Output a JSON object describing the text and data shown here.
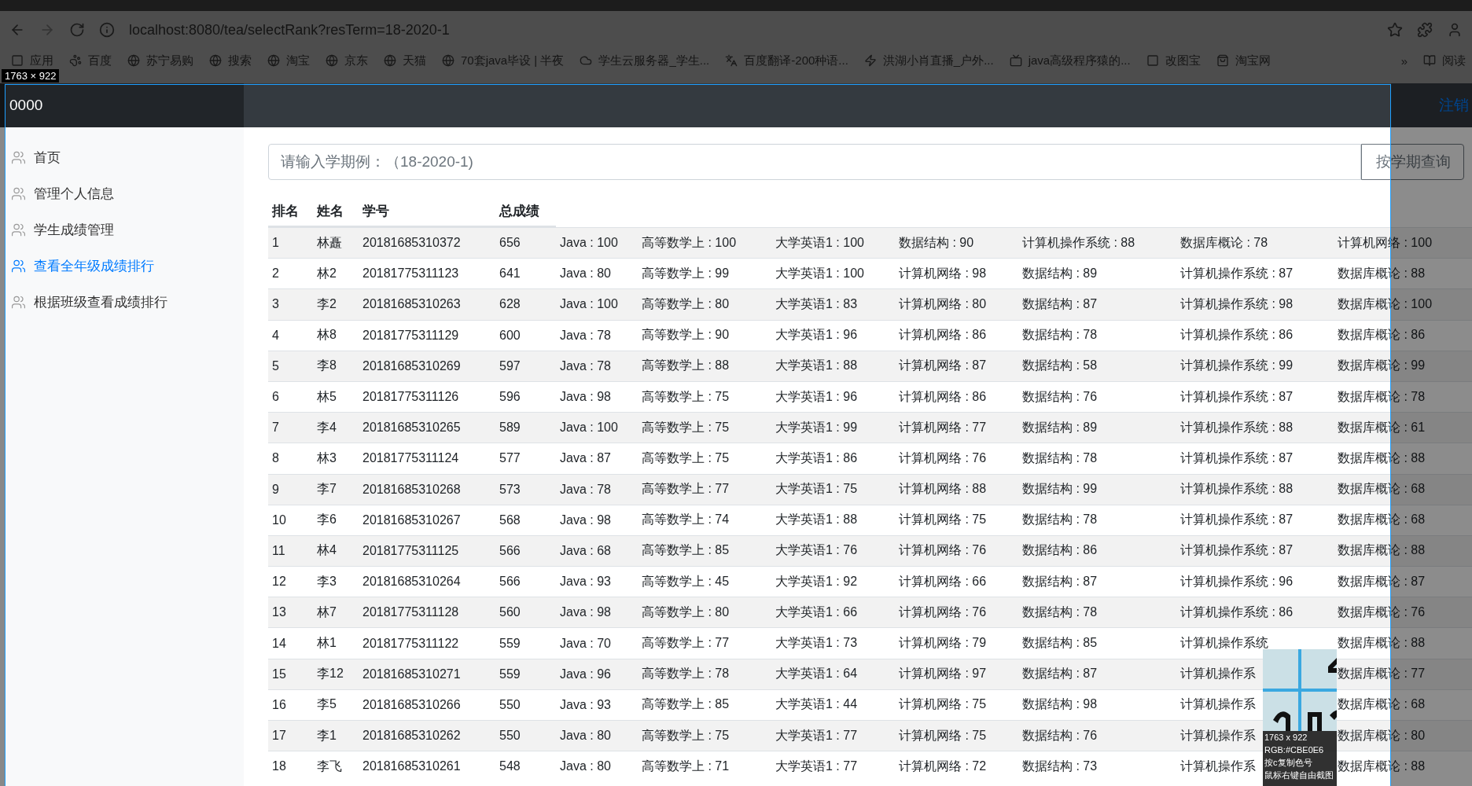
{
  "browser": {
    "url": "localhost:8080/tea/selectRank?resTerm=18-2020-1",
    "bookmarks": [
      "应用",
      "百度",
      "苏宁易购",
      "搜索",
      "淘宝",
      "京东",
      "天猫",
      "70套java毕设 | 半夜",
      "学生云服务器_学生...",
      "百度翻译-200种语...",
      "洪湖小肖直播_户外...",
      "java高级程序猿的...",
      "改图宝",
      "淘宝网"
    ],
    "more": "»",
    "reading_list": "阅读"
  },
  "header": {
    "brand": "0000",
    "logout": "注销"
  },
  "sidebar": {
    "items": [
      {
        "label": "首页",
        "selected": false
      },
      {
        "label": "管理个人信息",
        "selected": false
      },
      {
        "label": "学生成绩管理",
        "selected": false
      },
      {
        "label": "查看全年级成绩排行",
        "selected": true
      },
      {
        "label": "根据班级查看成绩排行",
        "selected": false
      }
    ]
  },
  "search": {
    "placeholder": "请输入学期例：（18-2020-1)",
    "button": "按学期查询"
  },
  "table": {
    "columns": [
      "排名",
      "姓名",
      "学号",
      "总成绩"
    ],
    "rows": [
      {
        "cells": [
          "1",
          "林矗",
          "20181685310372",
          "656",
          "Java : 100",
          "高等数学上 : 100",
          "大学英语1 : 100",
          "数据结构 : 90",
          "计算机操作系统 : 88",
          "数据库概论 : 78",
          "计算机网络 : 100"
        ]
      },
      {
        "cells": [
          "2",
          "林2",
          "20181775311123",
          "641",
          "Java : 80",
          "高等数学上 : 99",
          "大学英语1 : 100",
          "计算机网络 : 98",
          "数据结构 : 89",
          "计算机操作系统 : 87",
          "数据库概论 : 88"
        ]
      },
      {
        "cells": [
          "3",
          "李2",
          "20181685310263",
          "628",
          "Java : 100",
          "高等数学上 : 80",
          "大学英语1 : 83",
          "计算机网络 : 80",
          "数据结构 : 87",
          "计算机操作系统 : 98",
          "数据库概论 : 100"
        ]
      },
      {
        "cells": [
          "4",
          "林8",
          "20181775311129",
          "600",
          "Java : 78",
          "高等数学上 : 90",
          "大学英语1 : 96",
          "计算机网络 : 86",
          "数据结构 : 78",
          "计算机操作系统 : 86",
          "数据库概论 : 86"
        ]
      },
      {
        "cells": [
          "5",
          "李8",
          "20181685310269",
          "597",
          "Java : 78",
          "高等数学上 : 88",
          "大学英语1 : 88",
          "计算机网络 : 87",
          "数据结构 : 58",
          "计算机操作系统 : 99",
          "数据库概论 : 99"
        ]
      },
      {
        "cells": [
          "6",
          "林5",
          "20181775311126",
          "596",
          "Java : 98",
          "高等数学上 : 75",
          "大学英语1 : 96",
          "计算机网络 : 86",
          "数据结构 : 76",
          "计算机操作系统 : 87",
          "数据库概论 : 78"
        ]
      },
      {
        "cells": [
          "7",
          "李4",
          "20181685310265",
          "589",
          "Java : 100",
          "高等数学上 : 75",
          "大学英语1 : 99",
          "计算机网络 : 77",
          "数据结构 : 89",
          "计算机操作系统 : 88",
          "数据库概论 : 61"
        ]
      },
      {
        "cells": [
          "8",
          "林3",
          "20181775311124",
          "577",
          "Java : 87",
          "高等数学上 : 75",
          "大学英语1 : 86",
          "计算机网络 : 76",
          "数据结构 : 78",
          "计算机操作系统 : 87",
          "数据库概论 : 88"
        ]
      },
      {
        "cells": [
          "9",
          "李7",
          "20181685310268",
          "573",
          "Java : 78",
          "高等数学上 : 77",
          "大学英语1 : 75",
          "计算机网络 : 88",
          "数据结构 : 99",
          "计算机操作系统 : 88",
          "数据库概论 : 68"
        ]
      },
      {
        "cells": [
          "10",
          "李6",
          "20181685310267",
          "568",
          "Java : 98",
          "高等数学上 : 74",
          "大学英语1 : 88",
          "计算机网络 : 75",
          "数据结构 : 78",
          "计算机操作系统 : 87",
          "数据库概论 : 68"
        ]
      },
      {
        "cells": [
          "11",
          "林4",
          "20181775311125",
          "566",
          "Java : 68",
          "高等数学上 : 85",
          "大学英语1 : 76",
          "计算机网络 : 76",
          "数据结构 : 86",
          "计算机操作系统 : 87",
          "数据库概论 : 88"
        ]
      },
      {
        "cells": [
          "12",
          "李3",
          "20181685310264",
          "566",
          "Java : 93",
          "高等数学上 : 45",
          "大学英语1 : 92",
          "计算机网络 : 66",
          "数据结构 : 87",
          "计算机操作系统 : 96",
          "数据库概论 : 87"
        ]
      },
      {
        "cells": [
          "13",
          "林7",
          "20181775311128",
          "560",
          "Java : 98",
          "高等数学上 : 80",
          "大学英语1 : 66",
          "计算机网络 : 76",
          "数据结构 : 78",
          "计算机操作系统 : 86",
          "数据库概论 : 76"
        ]
      },
      {
        "cells": [
          "14",
          "林1",
          "20181775311122",
          "559",
          "Java : 70",
          "高等数学上 : 77",
          "大学英语1 : 73",
          "计算机网络 : 79",
          "数据结构 : 85",
          "计算机操作系统",
          "数据库概论 : 88"
        ]
      },
      {
        "cells": [
          "15",
          "李12",
          "20181685310271",
          "559",
          "Java : 96",
          "高等数学上 : 78",
          "大学英语1 : 64",
          "计算机网络 : 97",
          "数据结构 : 87",
          "计算机操作系",
          "数据库概论 : 77"
        ]
      },
      {
        "cells": [
          "16",
          "李5",
          "20181685310266",
          "550",
          "Java : 93",
          "高等数学上 : 85",
          "大学英语1 : 44",
          "计算机网络 : 75",
          "数据结构 : 98",
          "计算机操作系",
          "数据库概论 : 68"
        ]
      },
      {
        "cells": [
          "17",
          "李1",
          "20181685310262",
          "550",
          "Java : 80",
          "高等数学上 : 75",
          "大学英语1 : 77",
          "计算机网络 : 75",
          "数据结构 : 76",
          "计算机操作系",
          "数据库概论 : 80"
        ]
      },
      {
        "cells": [
          "18",
          "李飞",
          "20181685310261",
          "548",
          "Java : 80",
          "高等数学上 : 71",
          "大学英语1 : 77",
          "计算机网络 : 72",
          "数据结构 : 73",
          "计算机操作系",
          "数据库概论 : 88"
        ]
      }
    ]
  },
  "capture_tool": {
    "size_label": "1763 × 922",
    "size": "1763 x 922",
    "color_readout": "RGB:#CBE0E6",
    "hint_copy": "按c复制色号",
    "hint_free": "鼠标右键自由截图"
  }
}
